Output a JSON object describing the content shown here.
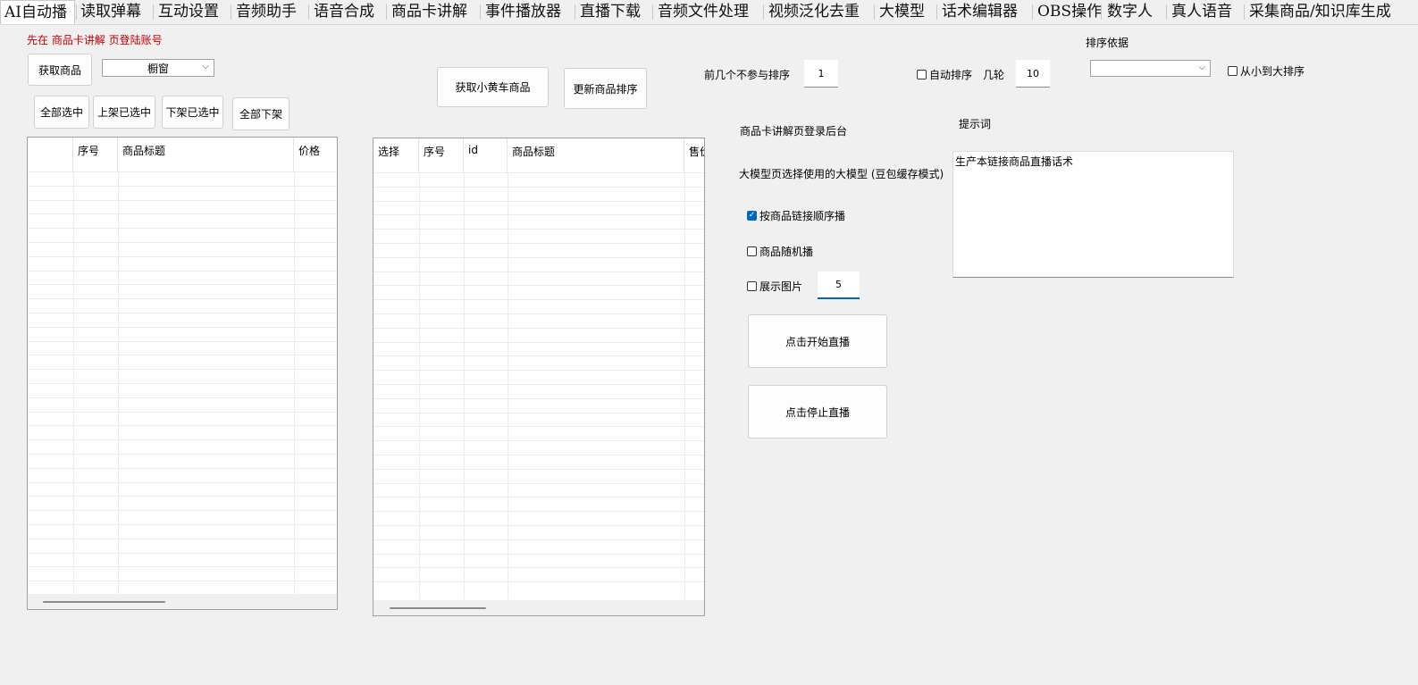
{
  "tabs": [
    {
      "label": "AI自动播",
      "active": true
    },
    {
      "label": "读取弹幕"
    },
    {
      "label": "互动设置"
    },
    {
      "label": "音频助手"
    },
    {
      "label": "语音合成"
    },
    {
      "label": "商品卡讲解"
    },
    {
      "label": "事件播放器"
    },
    {
      "label": "直播下载"
    },
    {
      "label": "音频文件处理"
    },
    {
      "label": "视频泛化去重"
    },
    {
      "label": "大模型"
    },
    {
      "label": "话术编辑器"
    },
    {
      "label": "OBS操作"
    },
    {
      "label": "数字人"
    },
    {
      "label": "真人语音"
    },
    {
      "label": "采集商品/知识库生成"
    }
  ],
  "left_panel": {
    "warning": "先在 商品卡讲解 页登陆账号",
    "fetch_button": "获取商品",
    "source_select": {
      "value": "橱窗"
    },
    "select_all_button": "全部选中",
    "list_selected_button": "上架已选中",
    "unlist_selected_button": "下架已选中",
    "unlist_all_button": "全部下架",
    "grid_columns": [
      "",
      "序号",
      "商品标题",
      "价格"
    ]
  },
  "middle_panel": {
    "fetch_cart_button": "获取小黄车商品",
    "update_sort_button": "更新商品排序",
    "grid_columns": [
      "选择",
      "序号",
      "id",
      "商品标题",
      "售价"
    ]
  },
  "right_panel": {
    "skip_sort_label": "前几个不参与排序",
    "skip_sort_value": "1",
    "auto_sort_label": "自动排序",
    "auto_sort_checked": false,
    "rounds_label": "几轮",
    "rounds_value": "10",
    "sort_basis_label": "排序依据",
    "sort_basis_value": "",
    "ascending_label": "从小到大排序",
    "ascending_checked": false,
    "login_hint": "商品卡讲解页登录后台",
    "model_hint": "大模型页选择使用的大模型 (豆包缓存模式)",
    "prompt_label": "提示词",
    "prompt_value": "生产本链接商品直播话术",
    "option_sequential": {
      "label": "按商品链接顺序播",
      "checked": true
    },
    "option_random": {
      "label": "商品随机播",
      "checked": false
    },
    "option_show_image": {
      "label": "展示图片",
      "checked": false
    },
    "show_image_value": "5",
    "start_button": "点击开始直播",
    "stop_button": "点击停止直播"
  },
  "colors": {
    "warning": "#c00000",
    "accent": "#0067c0",
    "window_bg": "#f0f0f0"
  }
}
